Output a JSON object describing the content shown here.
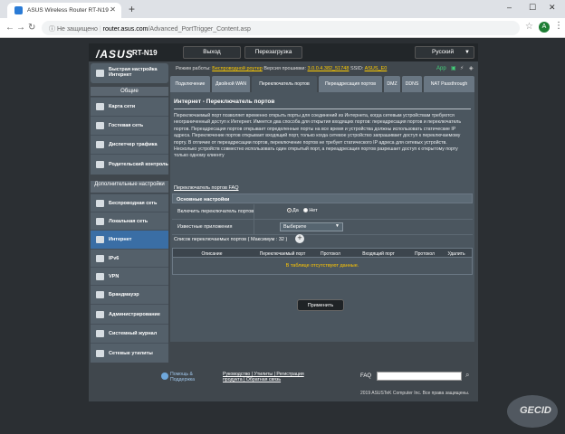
{
  "browser": {
    "tab_title": "ASUS Wireless Router RT-N19 - ",
    "newtab": "+",
    "min": "–",
    "max": "☐",
    "close": "✕",
    "warning": "ⓘ Не защищено",
    "host": "router.asus.com",
    "path": "/Advanced_PortTrigger_Content.asp",
    "avatar": "A"
  },
  "router": {
    "logo": "/ASUS",
    "model": "RT-N19",
    "logout": "Выход",
    "reboot": "Перезагрузка",
    "language": "Русский",
    "status": {
      "mode_label": "Режим работы:",
      "mode": "Беспроводной роутер",
      "fw_label": "Версия прошивки:",
      "fw": "3.0.0.4.382_51748",
      "ssid_label": "SSID:",
      "ssid": "ASUS_E0",
      "app": "App"
    },
    "sidebar": {
      "quick_setup": "Быстрая настройка Интернет",
      "general": "Общие",
      "items_general": [
        "Карта сети",
        "Гостевая сеть",
        "Диспетчер трафика",
        "Родительский контроль"
      ],
      "advanced": "Дополнительные настройки",
      "items_advanced": [
        "Беспроводная сеть",
        "Локальная сеть",
        "Интернет",
        "IPv6",
        "VPN",
        "Брандмауэр",
        "Администрирование",
        "Системный журнал",
        "Сетевые утилиты"
      ]
    },
    "tabs": [
      "Подключение",
      "Двойной WAN",
      "Переключатель портов",
      "Переадресация портов",
      "DMZ",
      "DDNS",
      "NAT Passthrough"
    ],
    "panel": {
      "title": "Интернет - Переключатель портов",
      "desc": "Переключаемый порт позволяет временно открыть порты для соединений из Интернета, когда сетевым устройствам требуются неограниченный доступ к Интернет. Имеется два способа для открытия входящих портов: переадресация портов и переключатель портов. Переадресация портов открывает определенные порты на все время и устройства должны использовать статические IP адреса. Переключение портов открывает входящий порт, только когда сетевое устройство запрашивает доступ к переключаемому порту. В отличие от переадресации портов, переключение портов не требует статического IP адреса для сетевых устройств. Несколько устройств совместно использовать один открытый порт, а переадресация портов разрешает доступ к открытому порту только одному клиенту",
      "faq": "Переключатель портов FAQ",
      "basic": "Основные настройки",
      "enable_label": "Включить переключатель портов",
      "yes": "Да",
      "no": "Нет",
      "known_apps_label": "Известные приложения",
      "select": "Выберите",
      "list_label": "Список переключаемых портов ( Максимум : 32 )",
      "add": "+",
      "columns": [
        "Описание",
        "Переключаемый порт",
        "Протокол",
        "Входящий порт",
        "Протокол",
        "Удалить"
      ],
      "empty": "В таблице отсутствуют данные.",
      "apply": "Применить"
    },
    "footer": {
      "help": "Помощь & Поддержка",
      "links": "Руководство | Утилиты | Регистрация продукта | Обратная связь",
      "faq": "FAQ",
      "copyright": "2019 ASUSTeK Computer Inc. Все права защищены."
    }
  },
  "watermark": "GECID"
}
